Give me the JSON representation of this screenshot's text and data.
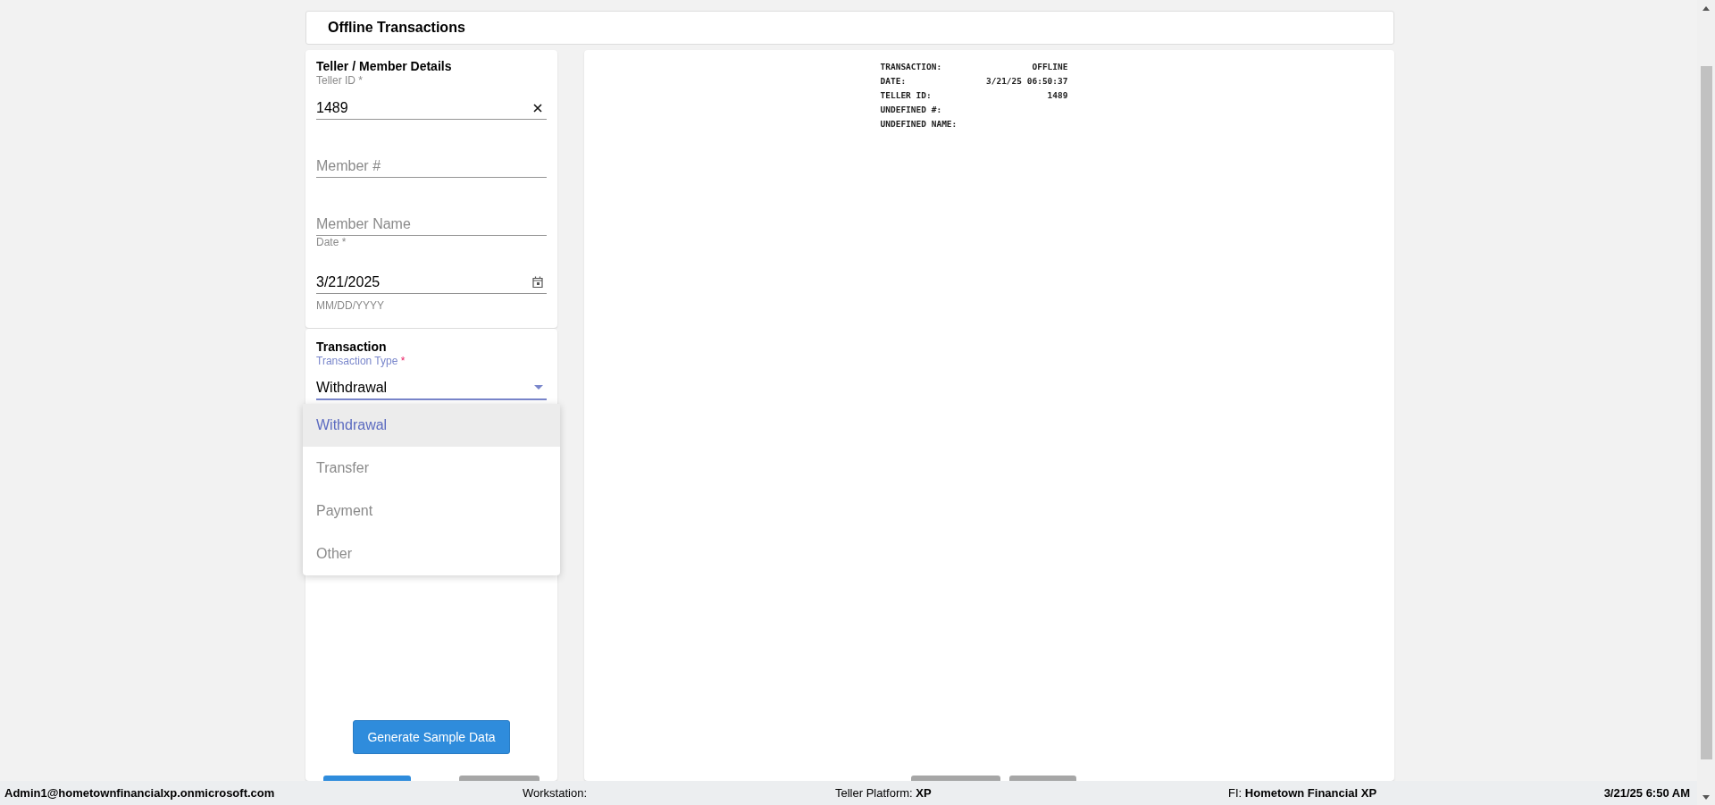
{
  "title": "Offline Transactions",
  "member_details": {
    "heading": "Teller / Member Details",
    "fields": [
      {
        "kind": "text",
        "label": "Teller ID *",
        "value": "1489",
        "clearable": true
      },
      {
        "kind": "text",
        "placeholder": "Member #"
      },
      {
        "kind": "text",
        "placeholder": "Member Name"
      },
      {
        "kind": "date",
        "label": "Date *",
        "value": "3/21/2025",
        "hint": "MM/DD/YYYY"
      }
    ]
  },
  "transaction": {
    "heading": "Transaction",
    "fields": [
      {
        "kind": "select",
        "label": "Transaction Type",
        "required_mark": "*",
        "value": "Withdrawal",
        "focused": true
      }
    ],
    "menu": [
      {
        "label": "Withdrawal",
        "selected": true
      },
      {
        "label": "Transfer",
        "selected": false
      },
      {
        "label": "Payment",
        "selected": false
      },
      {
        "label": "Other",
        "selected": false
      }
    ],
    "generate_button": "Generate Sample Data"
  },
  "receipt": [
    {
      "label": "TRANSACTION:",
      "value": "OFFLINE"
    },
    {
      "label": "DATE:",
      "value": "3/21/25 06:50:37"
    },
    {
      "label": "TELLER ID:",
      "value": "1489"
    },
    {
      "label": "UNDEFINED #:"
    },
    {
      "label": "UNDEFINED NAME:"
    }
  ],
  "status_bar": {
    "user": "Admin1@hometownfinancialxp.onmicrosoft.com",
    "workstation_label": "Workstation:",
    "platform_label": "Teller Platform:",
    "platform": "XP",
    "fi_label": "FI:",
    "fi": "Hometown Financial XP",
    "time": "3/21/25 6:50 AM"
  }
}
